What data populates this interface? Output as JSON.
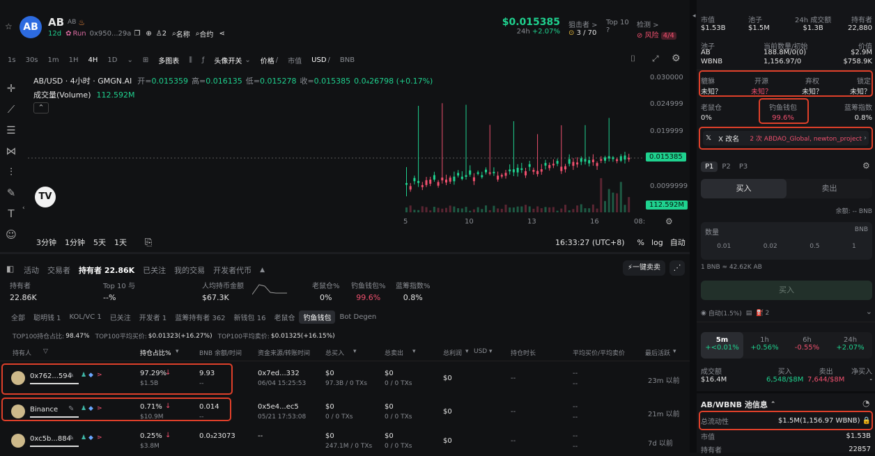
{
  "header": {
    "name": "AB",
    "ticker": "AB",
    "age": "12d",
    "run": "Run",
    "addr": "0x950...29a",
    "holders_icon_count": "2",
    "name_search": "名称",
    "contract_search": "合约",
    "price": "$0.015385",
    "change_label": "24h",
    "change": "+2.07%",
    "sniper_label": "狙击者 >",
    "sniper_val": "3 / 70",
    "top10_label": "Top 10",
    "top10_val": "?",
    "check_label": "检测 >",
    "risk_label": "风险",
    "risk_val": "4/4"
  },
  "toolbar": {
    "intervals": [
      "1s",
      "30s",
      "1m",
      "1H",
      "4H",
      "1D"
    ],
    "active_interval": "4H",
    "multi_chart": "多图表",
    "avatar_toggle": "头像开关",
    "price_label": "价格",
    "mcap_label": "市值",
    "usd": "USD",
    "bnb": "BNB"
  },
  "chart": {
    "title": "AB/USD · 4小时 · GMGN.AI",
    "open_label": "开=",
    "open": "0.015359",
    "high_label": "高=",
    "high": "0.016135",
    "low_label": "低=",
    "low": "0.015278",
    "close_label": "收=",
    "close": "0.015385",
    "change": "0.0₄26798 (+0.17%)",
    "volume_label": "成交量(Volume)",
    "volume": "112.592M",
    "y_ticks": [
      "0.030000",
      "0.024999",
      "0.019999",
      "0.0099999"
    ],
    "price_tag": "0.015385",
    "vol_tag": "112.592M",
    "x_ticks": [
      "5",
      "10",
      "13",
      "16",
      "08:"
    ],
    "ranges": [
      "3分钟",
      "1分钟",
      "5天",
      "1天"
    ],
    "time": "16:33:27 (UTC+8)",
    "pct": "%",
    "log": "log",
    "auto": "自动"
  },
  "tabs": {
    "items": [
      "活动",
      "交易者",
      "持有者 22.86K",
      "已关注",
      "我的交易",
      "开发者代币"
    ],
    "active": "持有者 22.86K",
    "one_click_sell": "一键卖卖"
  },
  "stats": [
    {
      "label": "持有者",
      "value": "22.86K"
    },
    {
      "label": "Top 10 与",
      "value": "--%"
    },
    {
      "label": "人均持币金额",
      "value": "$67.3K"
    },
    {
      "label": "老鼠仓%",
      "value": "0%"
    },
    {
      "label": "钓鱼钱包%",
      "value": "99.6%"
    },
    {
      "label": "蓝筹指数%",
      "value": "0.8%"
    }
  ],
  "filters": [
    "全部",
    "聪明钱 1",
    "KOL/VC 1",
    "已关注",
    "开发者 1",
    "蓝筹持有者 362",
    "新钱包 16",
    "老鼠仓",
    "钓鱼钱包",
    "Bot Degen"
  ],
  "active_filter": "钓鱼钱包",
  "summary": {
    "a_label": "TOP100持仓占比:",
    "a_val": "98.47%",
    "b_label": "TOP100平均买价:",
    "b_val": "$0.01323(+16.27%)",
    "c_label": "TOP100平均卖价:",
    "c_val": "$0.01325(+16.15%)"
  },
  "table": {
    "headers": [
      "持有人",
      "持仓占比%",
      "BNB 余额/时间",
      "资金来源/转账时间",
      "总买入",
      "总卖出",
      "总利润",
      "USD",
      "持仓时长",
      "平均买价/平均卖价",
      "最后活跃"
    ],
    "rows": [
      {
        "holder": "0x762...594",
        "pct": "97.29%",
        "usd": "$1.5B",
        "bnb": "9.93",
        "bnb2": "--",
        "src": "0x7ed...332",
        "src_time": "06/04 15:25:53",
        "buy": "$0",
        "buy2": "97.3B / 0 TXs",
        "sell": "$0",
        "sell2": "0 / 0 TXs",
        "profit": "$0",
        "dur": "--",
        "avg": "--",
        "avg2": "--",
        "last": "23m 以前"
      },
      {
        "holder": "Binance",
        "pct": "0.71%",
        "usd": "$10.9M",
        "bnb": "0.014",
        "bnb2": "--",
        "src": "0x5e4...ec5",
        "src_time": "05/21 17:53:08",
        "buy": "$0",
        "buy2": "0 / 0 TXs",
        "sell": "$0",
        "sell2": "0 / 0 TXs",
        "profit": "$0",
        "dur": "--",
        "avg": "--",
        "avg2": "--",
        "last": "21m 以前"
      },
      {
        "holder": "0xc5b...884",
        "pct": "0.25%",
        "usd": "$3.8M",
        "bnb": "0.0₃23073",
        "bnb2": "",
        "src": "--",
        "src_time": "",
        "buy": "$0",
        "buy2": "247.1M / 0 TXs",
        "sell": "$0",
        "sell2": "0 / 0 TXs",
        "profit": "$0",
        "dur": "--",
        "avg": "--",
        "avg2": "--",
        "last": "7d 以前"
      }
    ]
  },
  "right": {
    "top": [
      {
        "label": "市值",
        "value": "$1.53B"
      },
      {
        "label": "池子",
        "value": "$1.5M"
      },
      {
        "label": "24h 成交额",
        "value": "$1.3B"
      },
      {
        "label": "持有者",
        "value": "22,880"
      }
    ],
    "pool_hdr": [
      "池子",
      "当前数量/初始",
      "价值"
    ],
    "pool": [
      {
        "t": "AB",
        "q": "188.8M/0(0)",
        "v": "$2.9M"
      },
      {
        "t": "WBNB",
        "q": "1,156.97/0",
        "v": "$758.9K"
      }
    ],
    "security": [
      {
        "label": "貔貅",
        "value": "未知？"
      },
      {
        "label": "开源",
        "value": "未知？"
      },
      {
        "label": "弃权",
        "value": "未知？"
      },
      {
        "label": "锁定",
        "value": "未知？"
      }
    ],
    "wallets": [
      {
        "label": "老鼠仓",
        "value": "0%"
      },
      {
        "label": "钓鱼钱包",
        "value": "99.6%"
      },
      {
        "label": "蓝筹指数",
        "value": "0.8%"
      }
    ],
    "rename_label": "X 改名",
    "rename_val": "2 次 ABDAO_Global, newton_project",
    "presets": [
      "P1",
      "P2",
      "P3"
    ],
    "buy": "买入",
    "sell": "卖出",
    "balance": "余额: -- BNB",
    "qty_label": "数量",
    "qty_unit": "BNB",
    "amounts": [
      "0.01",
      "0.02",
      "0.5",
      "1"
    ],
    "rate": "1 BNB ≈ 42.62K AB",
    "buy_btn": "买入",
    "auto": "自动(1.5%)",
    "wallet_count": "2",
    "periods": [
      {
        "p": "5m",
        "v": "+<0.01%"
      },
      {
        "p": "1h",
        "v": "+0.56%"
      },
      {
        "p": "6h",
        "v": "-0.55%"
      },
      {
        "p": "24h",
        "v": "+2.07%"
      }
    ],
    "vol": [
      {
        "label": "成交额",
        "value": "$16.4M"
      },
      {
        "label": "买入",
        "value": "6,548/$8M"
      },
      {
        "label": "卖出",
        "value": "7,644/$8M"
      },
      {
        "label": "净买入",
        "value": "-"
      }
    ],
    "pool_info": "AB/WBNB 池信息",
    "liq_label": "总流动性",
    "liq_val": "$1.5M(1,156.97 WBNB)",
    "mcap_label": "市值",
    "mcap_val": "$1.53B",
    "holders_label": "持有者",
    "holders_val": "22857"
  }
}
